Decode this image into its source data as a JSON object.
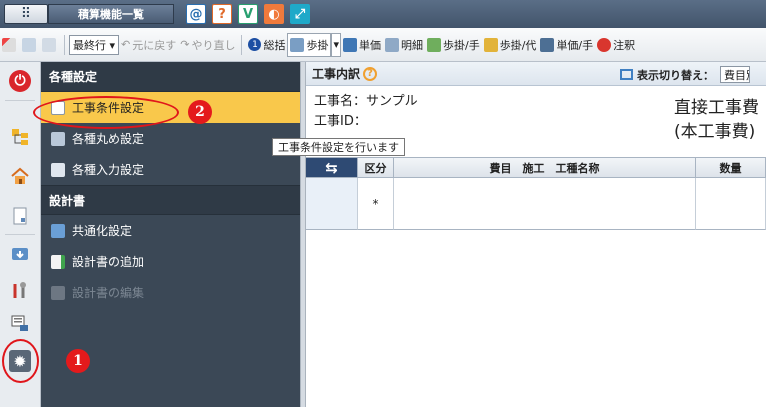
{
  "window": {
    "title": "積算機能一覧"
  },
  "toolbar": {
    "row_select": "最終行 ▾",
    "undo": "元に戻す",
    "redo": "やり直し",
    "summary": "総括",
    "progress": "歩掛",
    "unit_price": "単価",
    "details": "明細",
    "progress_hand": "歩掛/手",
    "progress_sub": "歩掛/代",
    "unit_price_hand": "単価/手",
    "note": "注釈"
  },
  "menu": {
    "section1": "各種設定",
    "items1": [
      "工事条件設定",
      "各種丸め設定",
      "各種入力設定"
    ],
    "section2": "設計書",
    "items2": [
      "共通化設定",
      "設計書の追加",
      "設計書の編集"
    ]
  },
  "main": {
    "header": "工事内訳",
    "toggle_label": "表示切り替え：",
    "toggle_value": "費目別",
    "name_line": "工事名：サンプル",
    "id_line": "工事ID：",
    "cost_title": "直接工事費",
    "cost_sub": "(本工事費)",
    "tooltip": "工事条件設定を行います",
    "grid": {
      "headers": [
        "区分",
        "費目　施工　工種名称",
        "数量"
      ],
      "row1_col1": "*"
    }
  },
  "annotations": {
    "badge1": "1",
    "badge2": "2"
  },
  "colors": {
    "accent": "#f9c84b",
    "menu_bg": "#3b4856",
    "annotation": "#e41a1c"
  }
}
